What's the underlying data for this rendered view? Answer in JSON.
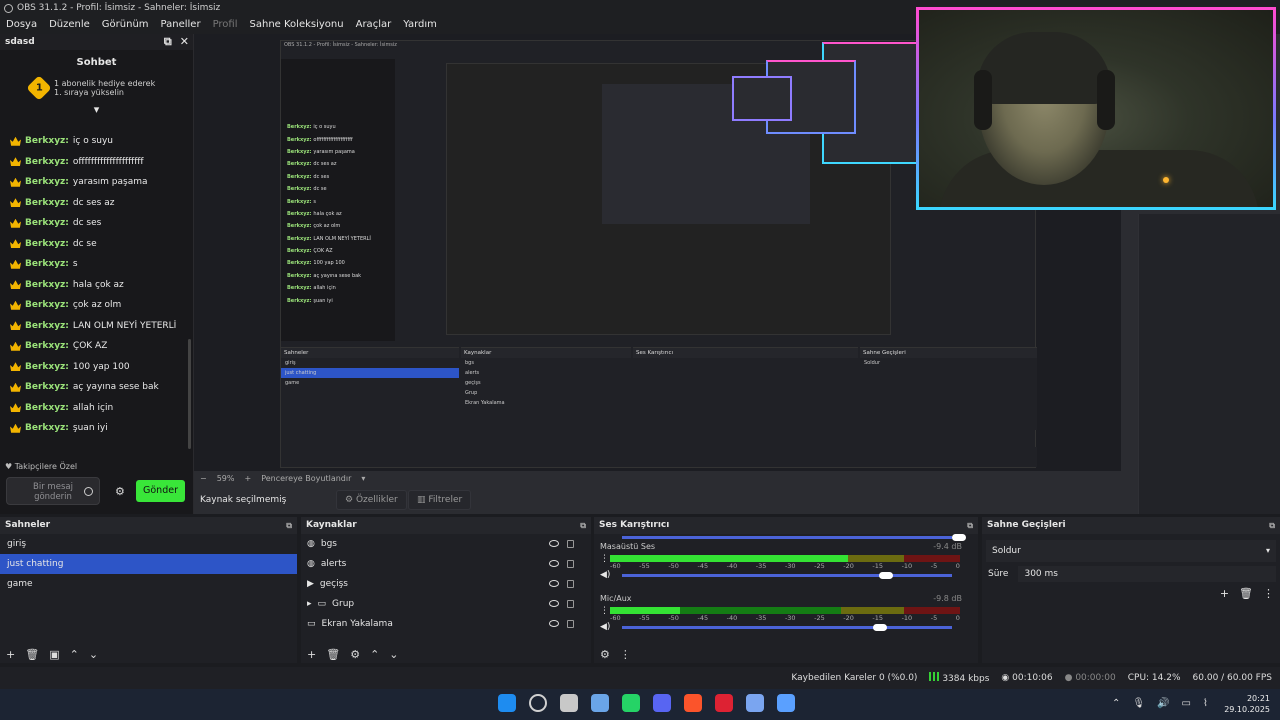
{
  "window": {
    "title": "OBS 31.1.2 - Profil: İsimsiz - Sahneler: İsimsiz"
  },
  "menu": [
    "Dosya",
    "Düzenle",
    "Görünüm",
    "Paneller",
    "Profil",
    "Sahne Koleksiyonu",
    "Araçlar",
    "Yardım"
  ],
  "chat": {
    "dock_title": "sdasd",
    "title": "Sohbet",
    "gift_line1": "1 abonelik hediye ederek",
    "gift_line2": "1. sıraya yükselin",
    "gift_rank": "1",
    "messages": [
      {
        "user": "Berkxyz:",
        "text": "iç o suyu"
      },
      {
        "user": "Berkxyz:",
        "text": "offfffffffffffffffffff"
      },
      {
        "user": "Berkxyz:",
        "text": "yarasım paşama"
      },
      {
        "user": "Berkxyz:",
        "text": "dc ses az"
      },
      {
        "user": "Berkxyz:",
        "text": "dc ses"
      },
      {
        "user": "Berkxyz:",
        "text": "dc se"
      },
      {
        "user": "Berkxyz:",
        "text": "s"
      },
      {
        "user": "Berkxyz:",
        "text": "hala çok az"
      },
      {
        "user": "Berkxyz:",
        "text": "çok az olm"
      },
      {
        "user": "Berkxyz:",
        "text": "LAN OLM NEYİ YETERLİ"
      },
      {
        "user": "Berkxyz:",
        "text": "ÇOK AZ"
      },
      {
        "user": "Berkxyz:",
        "text": "100 yap 100"
      },
      {
        "user": "Berkxyz:",
        "text": "aç yayına sese bak"
      },
      {
        "user": "Berkxyz:",
        "text": "allah için"
      },
      {
        "user": "Berkxyz:",
        "text": "şuan iyi"
      }
    ],
    "follower_label": "Takipçilere Özel",
    "input_placeholder_1": "Bir mesaj",
    "input_placeholder_2": "gönderin",
    "send_label": "Gönder"
  },
  "preview": {
    "zoom": "59%",
    "fit_label": "Pencereye Boyutlandır",
    "no_source": "Kaynak seçilmemiş",
    "properties_label": "Özellikler",
    "filters_label": "Filtreler"
  },
  "scenes": {
    "title": "Sahneler",
    "items": [
      "giriş",
      "just chatting",
      "game"
    ],
    "selected": "just chatting"
  },
  "sources": {
    "title": "Kaynaklar",
    "items": [
      "bgs",
      "alerts",
      "geçişs",
      "Grup",
      "Ekran Yakalama"
    ]
  },
  "mixer": {
    "title": "Ses Karıştırıcı",
    "channels": [
      {
        "name": "Masaüstü Ses",
        "db": "-9.4 dB",
        "level": 0.68,
        "volume": 0.78
      },
      {
        "name": "Mic/Aux",
        "db": "-9.8 dB",
        "level": 0.2,
        "volume": 0.76
      }
    ],
    "scale": [
      "-60",
      "-55",
      "-50",
      "-45",
      "-40",
      "-35",
      "-30",
      "-25",
      "-20",
      "-15",
      "-10",
      "-5",
      "0"
    ]
  },
  "transitions": {
    "title": "Sahne Geçişleri",
    "type": "Soldur",
    "duration_label": "Süre",
    "duration": "300 ms"
  },
  "status": {
    "dropped": "Kaybedilen Kareler 0 (%0.0)",
    "bitrate": "3384 kbps",
    "rec_time": "00:10:06",
    "stream_time": "00:00:00",
    "cpu": "CPU: 14.2%",
    "fps": "60.00 / 60.00 FPS"
  },
  "taskbar": {
    "time": "20:21",
    "date": "29.10.2025",
    "colors": [
      "#1e8cf0",
      "#d0d0d0",
      "#c8c8c8",
      "#6aa5e8",
      "#25d366",
      "#5865f2",
      "#fb542b",
      "#d23",
      "#7aa5f0",
      "#5aa0ff"
    ]
  }
}
